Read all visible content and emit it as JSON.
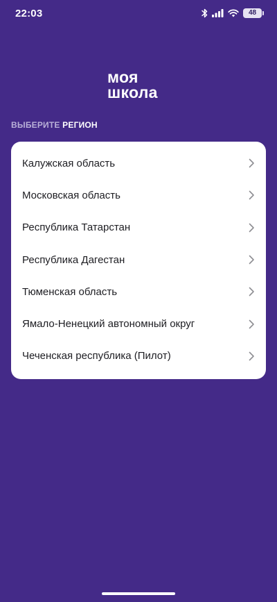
{
  "status_bar": {
    "time": "22:03",
    "battery": "48",
    "icons": [
      "bluetooth-icon",
      "signal-icon",
      "wifi-icon",
      "battery-icon"
    ]
  },
  "logo": {
    "line1": "моя",
    "line2": "школа"
  },
  "caption": {
    "muted": "ВЫБЕРИТЕ",
    "strong": "РЕГИОН"
  },
  "regions": [
    {
      "label": "Калужская область"
    },
    {
      "label": "Московская область"
    },
    {
      "label": "Республика Татарстан"
    },
    {
      "label": "Республика Дагестан"
    },
    {
      "label": "Тюменская область"
    },
    {
      "label": "Ямало-Ненецкий автономный округ"
    },
    {
      "label": "Чеченская республика (Пилот)"
    }
  ],
  "colors": {
    "background": "#442a88",
    "card": "#ffffff",
    "text_dark": "#1d1d22",
    "caption_muted": "#b9b0d8",
    "chevron": "#8e8e93"
  }
}
